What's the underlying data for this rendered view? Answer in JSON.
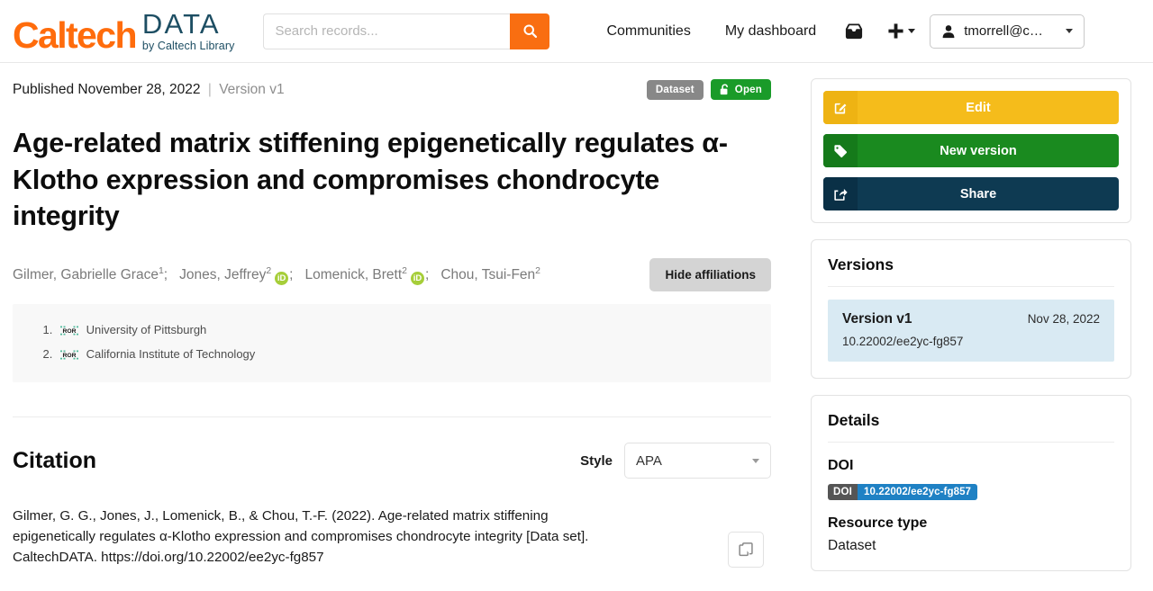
{
  "header": {
    "brand": {
      "caltech": "Caltech",
      "data": "DATA",
      "tagline": "by Caltech Library"
    },
    "search": {
      "placeholder": "Search records...",
      "value": "",
      "icon": "search-icon"
    },
    "nav": [
      {
        "label": "Communities",
        "name": "nav-communities"
      },
      {
        "label": "My dashboard",
        "name": "nav-my-dashboard"
      }
    ],
    "inbox_icon": "inbox-icon",
    "plus_icon": "plus-icon",
    "user": {
      "label": "tmorrell@c…",
      "icon": "user-icon",
      "caret": "chevron-down-icon"
    }
  },
  "record": {
    "published_label": "Published November 28, 2022",
    "separator": "|",
    "version_label": "Version v1",
    "badges": [
      {
        "label": "Dataset",
        "type": "resource",
        "color": "#888888"
      },
      {
        "label": "Open",
        "type": "access",
        "color": "#1a9b29",
        "icon": "unlock-icon"
      }
    ],
    "title": "Age-related matrix stiffening epigenetically regulates α-Klotho expression and compromises chondrocyte integrity",
    "authors": [
      {
        "name": "Gilmer, Gabrielle Grace",
        "affiliation_ref": "1",
        "orcid": false
      },
      {
        "name": "Jones, Jeffrey",
        "affiliation_ref": "2",
        "orcid": true
      },
      {
        "name": "Lomenick, Brett",
        "affiliation_ref": "2",
        "orcid": true
      },
      {
        "name": "Chou, Tsui-Fen",
        "affiliation_ref": "2",
        "orcid": false
      }
    ],
    "hide_affiliations_label": "Hide affiliations",
    "affiliations": [
      {
        "index": "1.",
        "icon": "ror-icon",
        "name": "University of Pittsburgh"
      },
      {
        "index": "2.",
        "icon": "ror-icon",
        "name": "California Institute of Technology"
      }
    ]
  },
  "citation": {
    "heading": "Citation",
    "style_label": "Style",
    "style_value": "APA",
    "text": "Gilmer, G. G., Jones, J., Lomenick, B., & Chou, T.-F. (2022). Age-related matrix stiffening epigenetically regulates α-Klotho expression and compromises chondrocyte integrity [Data set]. CaltechDATA. https://doi.org/10.22002/ee2yc-fg857",
    "copy_icon": "copy-icon"
  },
  "sidebar": {
    "actions": [
      {
        "label": "Edit",
        "name": "edit-button",
        "icon": "edit-icon",
        "color": "#F5BC1B"
      },
      {
        "label": "New version",
        "name": "new-version-button",
        "icon": "tag-icon",
        "color": "#1a8a1f"
      },
      {
        "label": "Share",
        "name": "share-button",
        "icon": "share-icon",
        "color": "#0E3A52"
      }
    ],
    "versions": {
      "title": "Versions",
      "items": [
        {
          "name": "Version v1",
          "date": "Nov 28, 2022",
          "doi": "10.22002/ee2yc-fg857"
        }
      ]
    },
    "details": {
      "title": "Details",
      "doi_label": "DOI",
      "doi_badge_key": "DOI",
      "doi_badge_value": "10.22002/ee2yc-fg857",
      "resource_type_label": "Resource type",
      "resource_type_value": "Dataset"
    }
  }
}
